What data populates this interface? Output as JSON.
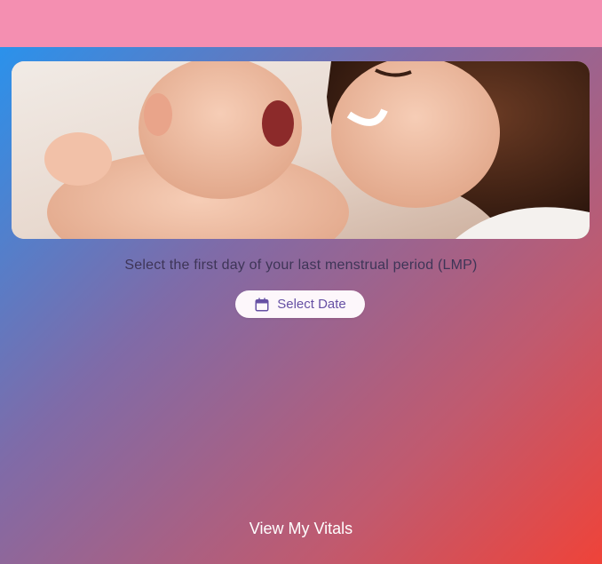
{
  "app_bar": {
    "color": "#f48fb1"
  },
  "hero": {
    "description_icon": "mother-and-baby-photo"
  },
  "lmp": {
    "prompt": "Select the first day of your last menstrual period (LMP)",
    "button_label": "Select Date",
    "button_icon": "calendar-icon"
  },
  "footer": {
    "vitals_link": "View My Vitals"
  },
  "colors": {
    "gradient_start": "#2196f3",
    "gradient_end": "#ef4339",
    "accent": "#6650a4"
  }
}
